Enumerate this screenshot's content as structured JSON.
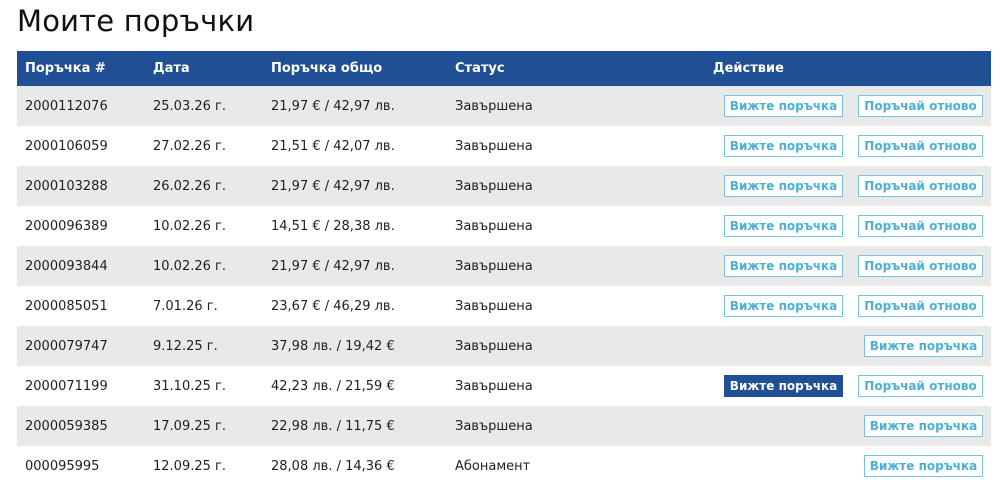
{
  "page": {
    "title": "Моите поръчки"
  },
  "table": {
    "headers": {
      "order": "Поръчка #",
      "date": "Дата",
      "total": "Поръчка общо",
      "status": "Статус",
      "action": "Действие"
    },
    "rows": [
      {
        "order": "2000112076",
        "date": "25.03.26 г.",
        "total": "21,97 € / 42,97 лв.",
        "status": "Завършена",
        "view_label": "Вижте поръчка",
        "reorder_label": "Поръчай отново",
        "has_reorder": true,
        "view_active": false
      },
      {
        "order": "2000106059",
        "date": "27.02.26 г.",
        "total": "21,51 € / 42,07 лв.",
        "status": "Завършена",
        "view_label": "Вижте поръчка",
        "reorder_label": "Поръчай отново",
        "has_reorder": true,
        "view_active": false
      },
      {
        "order": "2000103288",
        "date": "26.02.26 г.",
        "total": "21,97 € / 42,97 лв.",
        "status": "Завършена",
        "view_label": "Вижте поръчка",
        "reorder_label": "Поръчай отново",
        "has_reorder": true,
        "view_active": false
      },
      {
        "order": "2000096389",
        "date": "10.02.26 г.",
        "total": "14,51 € / 28,38 лв.",
        "status": "Завършена",
        "view_label": "Вижте поръчка",
        "reorder_label": "Поръчай отново",
        "has_reorder": true,
        "view_active": false
      },
      {
        "order": "2000093844",
        "date": "10.02.26 г.",
        "total": "21,97 € / 42,97 лв.",
        "status": "Завършена",
        "view_label": "Вижте поръчка",
        "reorder_label": "Поръчай отново",
        "has_reorder": true,
        "view_active": false
      },
      {
        "order": "2000085051",
        "date": "7.01.26 г.",
        "total": "23,67 € / 46,29 лв.",
        "status": "Завършена",
        "view_label": "Вижте поръчка",
        "reorder_label": "Поръчай отново",
        "has_reorder": true,
        "view_active": false
      },
      {
        "order": "2000079747",
        "date": "9.12.25 г.",
        "total": "37,98 лв. / 19,42 €",
        "status": "Завършена",
        "view_label": "Вижте поръчка",
        "has_reorder": false,
        "view_active": false
      },
      {
        "order": "2000071199",
        "date": "31.10.25 г.",
        "total": "42,23 лв. / 21,59 €",
        "status": "Завършена",
        "view_label": "Вижте поръчка",
        "reorder_label": "Поръчай отново",
        "has_reorder": true,
        "view_active": true
      },
      {
        "order": "2000059385",
        "date": "17.09.25 г.",
        "total": "22,98 лв. / 11,75 €",
        "status": "Завършена",
        "view_label": "Вижте поръчка",
        "has_reorder": false,
        "view_active": false
      },
      {
        "order": "000095995",
        "date": "12.09.25 г.",
        "total": "28,08 лв. / 14,36 €",
        "status": "Абонамент",
        "view_label": "Вижте поръчка",
        "has_reorder": false,
        "view_active": false
      }
    ]
  },
  "colors": {
    "header_bg": "#214f95",
    "row_alt_bg": "#e9e9e9",
    "button_border": "#75c3dd",
    "button_text": "#4ab0d4"
  }
}
